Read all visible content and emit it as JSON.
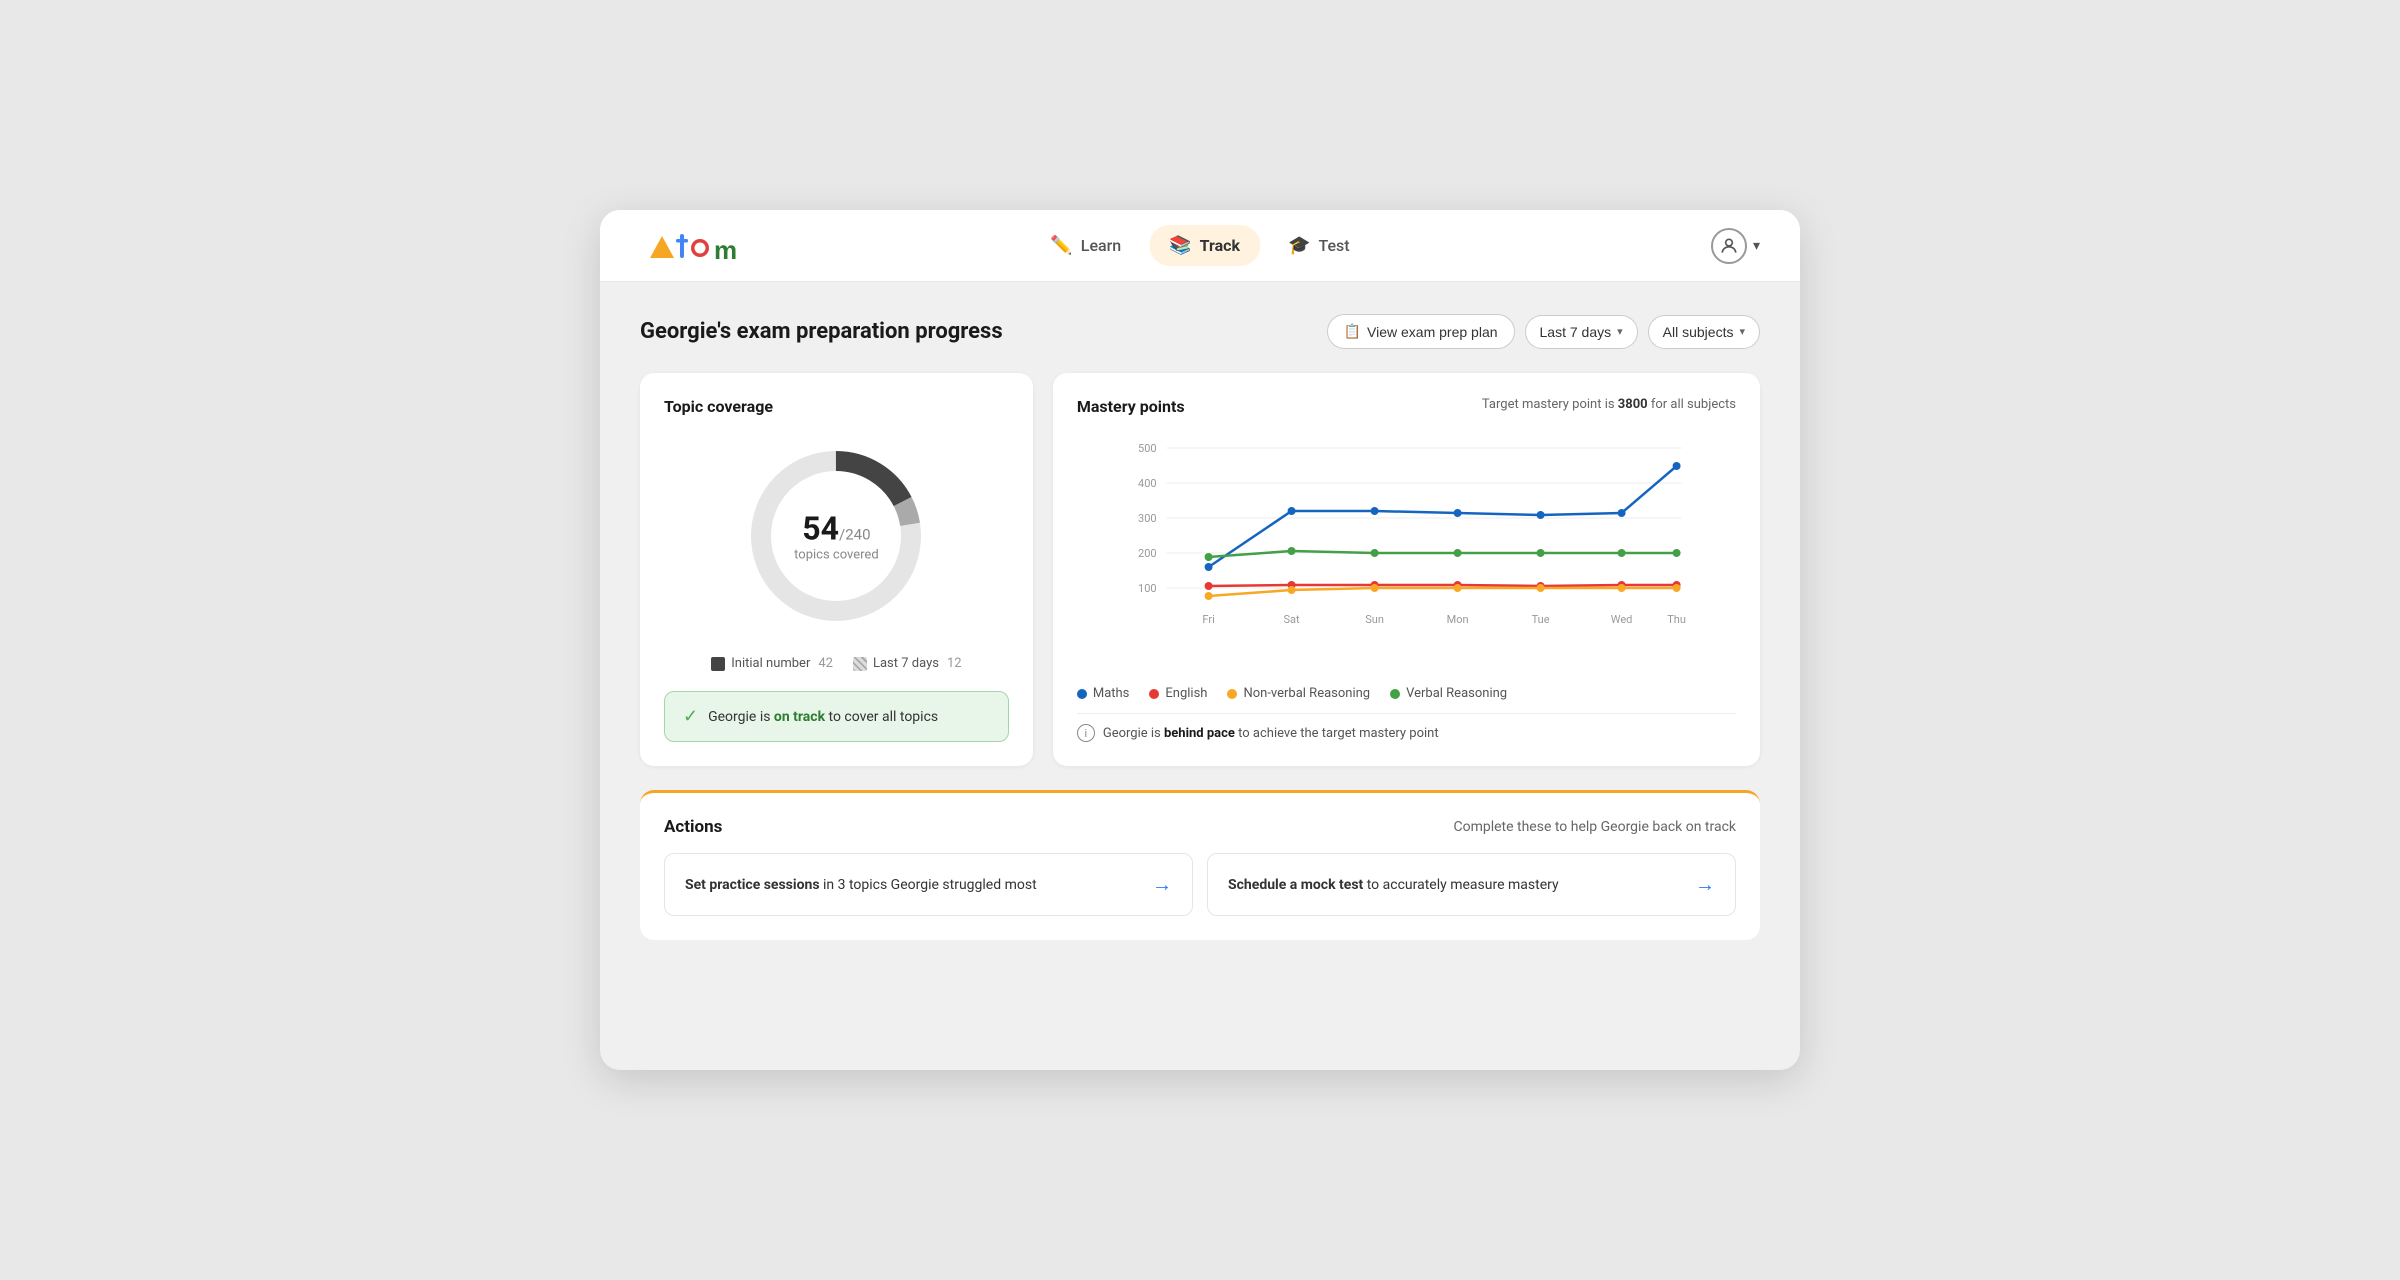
{
  "app": {
    "logo_text": "Atom"
  },
  "nav": {
    "items": [
      {
        "id": "learn",
        "label": "Learn",
        "icon": "✏️",
        "active": false
      },
      {
        "id": "track",
        "label": "Track",
        "icon": "📚",
        "active": true
      },
      {
        "id": "test",
        "label": "Test",
        "icon": "🎓",
        "active": false
      }
    ]
  },
  "page": {
    "title": "Georgie's exam preparation progress",
    "view_plan_label": "View exam prep plan",
    "date_filter": "Last 7 days",
    "subject_filter": "All subjects"
  },
  "topic_coverage": {
    "title": "Topic coverage",
    "covered": 54,
    "total": 240,
    "label": "topics covered",
    "initial_label": "Initial number",
    "initial_count": 42,
    "last7_label": "Last 7 days",
    "last7_count": 12,
    "status_text": "Georgie is on track to cover all topics",
    "status_highlight": "on track"
  },
  "mastery": {
    "title": "Mastery points",
    "target_prefix": "Target mastery point is ",
    "target_value": "3800",
    "target_suffix": " for all subjects",
    "y_labels": [
      "500",
      "400",
      "300",
      "200",
      "100"
    ],
    "x_labels": [
      "Fri",
      "Sat",
      "Sun",
      "Mon",
      "Tue",
      "Wed",
      "Thu"
    ],
    "lines": [
      {
        "label": "Maths",
        "color": "#1565C0",
        "values": [
          160,
          320,
          320,
          315,
          310,
          315,
          450
        ]
      },
      {
        "label": "English",
        "color": "#E53935",
        "values": [
          105,
          110,
          110,
          108,
          105,
          110,
          110
        ]
      },
      {
        "label": "Non-verbal Reasoning",
        "color": "#F9A825",
        "values": [
          70,
          95,
          100,
          100,
          98,
          100,
          100
        ]
      },
      {
        "label": "Verbal Reasoning",
        "color": "#43A047",
        "values": [
          190,
          205,
          200,
          198,
          200,
          198,
          200
        ]
      }
    ],
    "behind_text": "Georgie is behind pace to achieve the target mastery point",
    "behind_highlight": "behind pace"
  },
  "actions": {
    "title": "Actions",
    "subtitle": "Complete these to help Georgie back on track",
    "items": [
      {
        "text_pre": "Set practice sessions",
        "text_post": " in 3 topics Georgie struggled most"
      },
      {
        "text_pre": "Schedule a mock test",
        "text_post": " to accurately measure mastery"
      }
    ]
  }
}
